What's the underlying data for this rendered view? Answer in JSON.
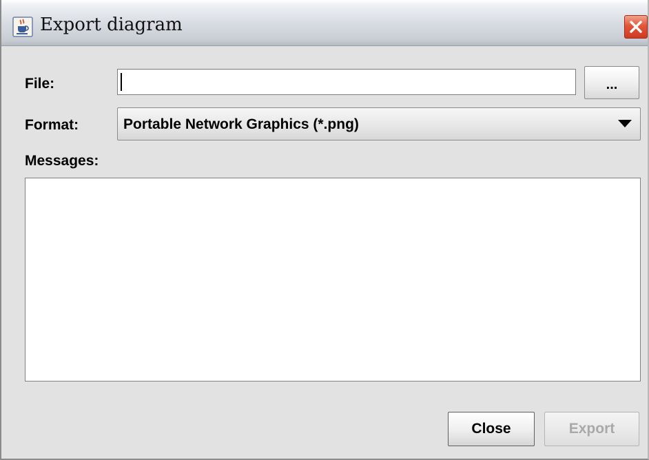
{
  "window": {
    "title": "Export diagram",
    "app_icon": "java-cup-icon",
    "close_icon": "close-icon"
  },
  "form": {
    "file_label": "File:",
    "file_value": "",
    "browse_label": "...",
    "format_label": "Format:",
    "format_selected": "Portable Network Graphics (*.png)",
    "dropdown_icon": "chevron-down-icon",
    "messages_label": "Messages:",
    "messages_value": ""
  },
  "buttons": {
    "close_label": "Close",
    "export_label": "Export",
    "export_enabled": false
  },
  "colors": {
    "window_bg": "#e2e2e2",
    "close_button": "#e2563a",
    "disabled_text": "#a9a9a9"
  }
}
